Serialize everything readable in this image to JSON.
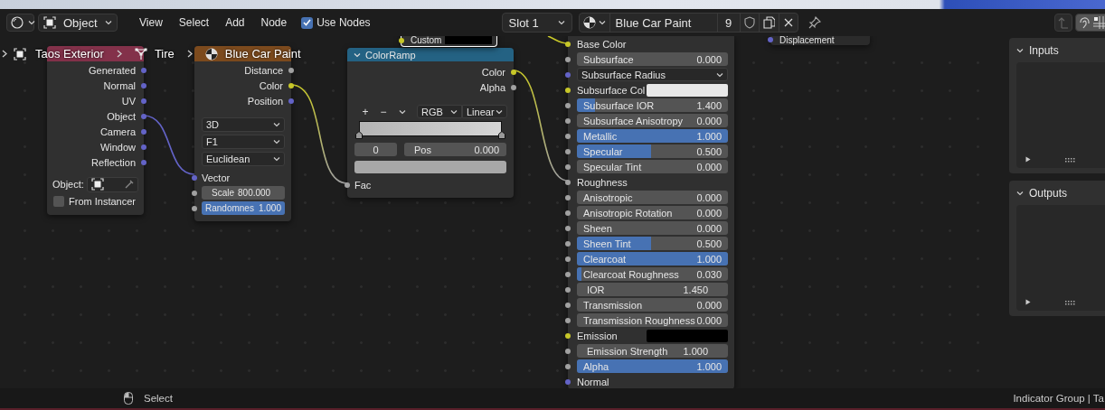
{
  "header": {
    "mode": "Object",
    "menus": [
      "View",
      "Select",
      "Add",
      "Node"
    ],
    "use_nodes": {
      "label": "Use Nodes",
      "checked": true
    },
    "slot": "Slot 1",
    "material": {
      "name": "Blue Car Paint",
      "users": "9"
    }
  },
  "breadcrumbs": [
    "Taos Exterior",
    "Tire",
    "Blue Car Paint"
  ],
  "nodes": [
    {
      "kind": "texture_coordinate",
      "outputs": [
        "Generated",
        "Normal",
        "UV",
        "Object",
        "Camera",
        "Window",
        "Reflection"
      ],
      "object_label": "Object:",
      "from_instancer": {
        "label": "From Instancer",
        "checked": false
      }
    },
    {
      "kind": "voronoi",
      "outputs": [
        {
          "label": "Distance",
          "socket": {
            "color": "#a1a1a1"
          }
        },
        {
          "label": "Color",
          "socket": {
            "color": "#c7c729"
          }
        },
        {
          "label": "Position",
          "socket": {
            "color": "#6363c7"
          }
        }
      ],
      "options": [
        "3D",
        "F1",
        "Euclidean"
      ],
      "inputs": [
        {
          "kind": "socket",
          "label": "Vector",
          "socket": {
            "color": "#6363c7"
          }
        },
        {
          "kind": "number",
          "label": "Scale",
          "value": "800.000",
          "socket": {
            "color": "#a1a1a1"
          }
        },
        {
          "kind": "slider",
          "label": "Randomnes",
          "value": "1.000",
          "level": 1,
          "socket": {
            "color": "#a1a1a1"
          }
        }
      ]
    },
    {
      "kind": "color_ramp",
      "title": "ColorRamp",
      "outputs": [
        {
          "label": "Color",
          "socket": {
            "color": "#c7c729"
          }
        },
        {
          "label": "Alpha",
          "socket": {
            "color": "#a1a1a1"
          }
        }
      ],
      "ramp_buttons": [
        "+",
        "−"
      ],
      "color_mode": "RGB",
      "interpolation": "Linear",
      "active_stop": {
        "index": "0",
        "color": "#a8a8a8"
      },
      "position": {
        "label": "Pos",
        "value": "0.000"
      },
      "inputs": [
        {
          "kind": "socket",
          "label": "Fac",
          "socket": {
            "color": "#a1a1a1"
          }
        }
      ]
    },
    {
      "kind": "principled",
      "inputs": [
        {
          "kind": "socket",
          "label": "Base Color",
          "socket": {
            "color": "#c7c729"
          }
        },
        {
          "kind": "slider",
          "label": "Subsurface",
          "value": "0.000",
          "socket": {
            "color": "#a1a1a1"
          }
        },
        {
          "kind": "dropdown",
          "label": "Subsurface Radius",
          "socket": {
            "color": "#6363c7"
          }
        },
        {
          "kind": "color",
          "label": "Subsurface Col",
          "color": "#e8e8e8",
          "socket": {
            "color": "#c7c729"
          }
        },
        {
          "kind": "slider",
          "label": "Subsurface IOR",
          "value": "1.400",
          "level": 0.12,
          "socket": {
            "color": "#a1a1a1"
          }
        },
        {
          "kind": "slider",
          "label": "Subsurface Anisotropy",
          "value": "0.000",
          "socket": {
            "color": "#a1a1a1"
          }
        },
        {
          "kind": "slider",
          "label": "Metallic",
          "value": "1.000",
          "level": 1,
          "socket": {
            "color": "#a1a1a1"
          }
        },
        {
          "kind": "slider",
          "label": "Specular",
          "value": "0.500",
          "level": 0.49,
          "socket": {
            "color": "#a1a1a1"
          }
        },
        {
          "kind": "slider",
          "label": "Specular Tint",
          "value": "0.000",
          "socket": {
            "color": "#a1a1a1"
          }
        },
        {
          "kind": "socket",
          "label": "Roughness",
          "socket": {
            "color": "#a1a1a1"
          }
        },
        {
          "kind": "slider",
          "label": "Anisotropic",
          "value": "0.000",
          "socket": {
            "color": "#a1a1a1"
          }
        },
        {
          "kind": "slider",
          "label": "Anisotropic Rotation",
          "value": "0.000",
          "socket": {
            "color": "#a1a1a1"
          }
        },
        {
          "kind": "slider",
          "label": "Sheen",
          "value": "0.000",
          "socket": {
            "color": "#a1a1a1"
          }
        },
        {
          "kind": "slider",
          "label": "Sheen Tint",
          "value": "0.500",
          "level": 0.49,
          "socket": {
            "color": "#a1a1a1"
          }
        },
        {
          "kind": "slider",
          "label": "Clearcoat",
          "value": "1.000",
          "level": 1,
          "socket": {
            "color": "#a1a1a1"
          }
        },
        {
          "kind": "slider",
          "label": "Clearcoat Roughness",
          "value": "0.030",
          "level": 0.03,
          "socket": {
            "color": "#a1a1a1"
          }
        },
        {
          "kind": "number",
          "label": "IOR",
          "value": "1.450",
          "socket": {
            "color": "#a1a1a1"
          }
        },
        {
          "kind": "slider",
          "label": "Transmission",
          "value": "0.000",
          "socket": {
            "color": "#a1a1a1"
          }
        },
        {
          "kind": "slider",
          "label": "Transmission Roughness",
          "value": "0.000",
          "socket": {
            "color": "#a1a1a1"
          }
        },
        {
          "kind": "color",
          "label": "Emission",
          "color": "#000000",
          "socket": {
            "color": "#c7c729"
          }
        },
        {
          "kind": "number",
          "label": "Emission Strength",
          "value": "1.000",
          "socket": {
            "color": "#a1a1a1"
          }
        },
        {
          "kind": "slider",
          "label": "Alpha",
          "value": "1.000",
          "level": 1,
          "socket": {
            "color": "#a1a1a1"
          }
        },
        {
          "kind": "socket",
          "label": "Normal",
          "socket": {
            "color": "#6363c7"
          }
        }
      ]
    },
    {
      "kind": "color_fragment",
      "label": "Custom",
      "color": "#000000",
      "socket": {
        "color": "#c7c729"
      }
    },
    {
      "kind": "output_fragment",
      "label": "Displacement",
      "socket": {
        "color": "#6363c7"
      }
    }
  ],
  "sidebar": {
    "sections": [
      {
        "title": "Inputs"
      },
      {
        "title": "Outputs"
      }
    ]
  },
  "status_bar": {
    "hint": "Select",
    "right": "Indicator Group | Ta"
  }
}
